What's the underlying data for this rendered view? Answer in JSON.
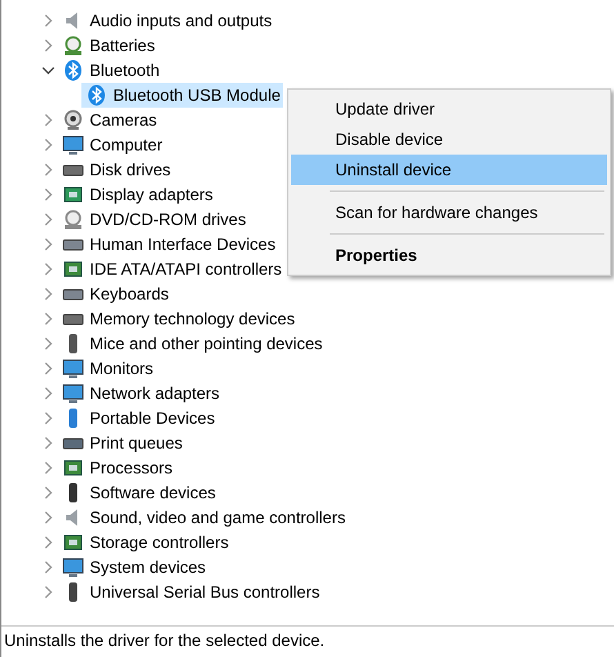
{
  "tree": {
    "categories": [
      {
        "label": "Audio inputs and outputs",
        "kind": "speaker",
        "expanded": false
      },
      {
        "label": "Batteries",
        "kind": "battery",
        "expanded": false
      },
      {
        "label": "Bluetooth",
        "kind": "bluetooth",
        "expanded": true,
        "children": [
          {
            "label": "Bluetooth USB Module",
            "kind": "bluetooth",
            "selected": true
          }
        ]
      },
      {
        "label": "Cameras",
        "kind": "camera",
        "expanded": false
      },
      {
        "label": "Computer",
        "kind": "monitor",
        "expanded": false
      },
      {
        "label": "Disk drives",
        "kind": "drive",
        "expanded": false
      },
      {
        "label": "Display adapters",
        "kind": "adapter",
        "expanded": false
      },
      {
        "label": "DVD/CD-ROM drives",
        "kind": "disc",
        "expanded": false
      },
      {
        "label": "Human Interface Devices",
        "kind": "keyboard",
        "expanded": false
      },
      {
        "label": "IDE ATA/ATAPI controllers",
        "kind": "chip",
        "expanded": false
      },
      {
        "label": "Keyboards",
        "kind": "keyboard",
        "expanded": false
      },
      {
        "label": "Memory technology devices",
        "kind": "drive",
        "expanded": false
      },
      {
        "label": "Mice and other pointing devices",
        "kind": "mouse",
        "expanded": false
      },
      {
        "label": "Monitors",
        "kind": "monitor",
        "expanded": false
      },
      {
        "label": "Network adapters",
        "kind": "network",
        "expanded": false
      },
      {
        "label": "Portable Devices",
        "kind": "phone",
        "expanded": false
      },
      {
        "label": "Print queues",
        "kind": "printer",
        "expanded": false
      },
      {
        "label": "Processors",
        "kind": "chip",
        "expanded": false
      },
      {
        "label": "Software devices",
        "kind": "tower",
        "expanded": false
      },
      {
        "label": "Sound, video and game controllers",
        "kind": "speaker",
        "expanded": false
      },
      {
        "label": "Storage controllers",
        "kind": "chip",
        "expanded": false
      },
      {
        "label": "System devices",
        "kind": "monitor",
        "expanded": false
      },
      {
        "label": "Universal Serial Bus controllers",
        "kind": "usb",
        "expanded": false
      }
    ]
  },
  "context_menu": {
    "items": [
      {
        "label": "Update driver",
        "selected": false,
        "bold": false
      },
      {
        "label": "Disable device",
        "selected": false,
        "bold": false,
        "separator_after": false
      },
      {
        "label": "Uninstall device",
        "selected": true,
        "bold": false,
        "separator_after": true
      },
      {
        "label": "Scan for hardware changes",
        "selected": false,
        "bold": false,
        "separator_after": true
      },
      {
        "label": "Properties",
        "selected": false,
        "bold": true
      }
    ]
  },
  "status_bar": {
    "text": "Uninstalls the driver for the selected device."
  }
}
